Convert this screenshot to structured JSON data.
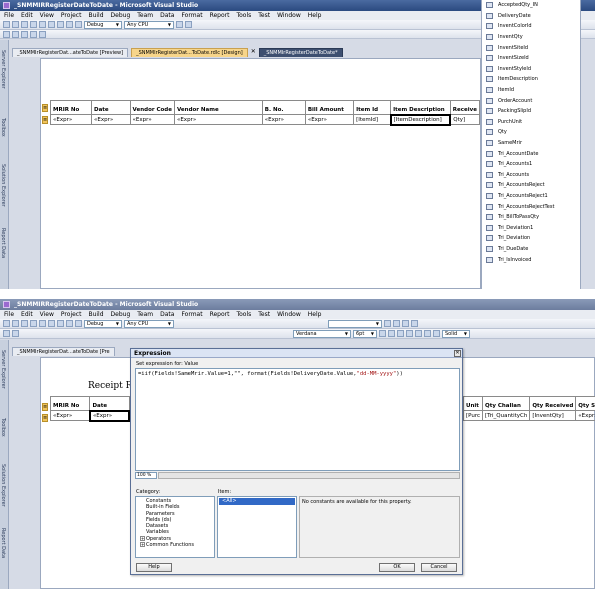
{
  "shot1": {
    "window_title": "_SNMMIRRegisterDateToDate - Microsoft Visual Studio",
    "menus": [
      "File",
      "Edit",
      "View",
      "Project",
      "Build",
      "Debug",
      "Team",
      "Data",
      "Format",
      "Report",
      "Tools",
      "Test",
      "Window",
      "Help"
    ],
    "config_combo": "Debug",
    "platform_combo": "Any CPU",
    "doc_tabs": [
      "_SNMMIrRegisterDat...ateToDate [Preview]",
      "_SNMMIrRegisterDat...ToDate.rdlc [Design]",
      "_SNMMIrRegisterDateToDate*"
    ],
    "side_tabs": [
      "Server Explorer",
      "Toolbox",
      "Solution Explorer",
      "Report Data"
    ],
    "table": {
      "headers": [
        "MRIR No",
        "Date",
        "Vendor Code",
        "Vendor Name",
        "B. No.",
        "Bill Amount",
        "Item Id",
        "Item Description",
        "Receive"
      ],
      "cells": [
        "«Expr»",
        "«Expr»",
        "«Expr»",
        "«Expr»",
        "«Expr»",
        "«Expr»",
        "[ItemId]",
        "[ItemDescription]",
        "Qty]"
      ]
    },
    "fields": [
      "AcceptedQty_IN",
      "DeliveryDate",
      "InventColorId",
      "InventQty",
      "InventSiteId",
      "InventSizeId",
      "InventStyleId",
      "ItemDescription",
      "ItemId",
      "OrderAccount",
      "PackingSlipId",
      "PurchUnit",
      "Qty",
      "SameMrir",
      "Tri_AccountDate",
      "Tri_Accounts1",
      "Tri_Accounts",
      "Tri_AccountsReject",
      "Tri_AccountsReject1",
      "Tri_AccountsRejectTest",
      "Tri_BillToPassQty",
      "Tri_Deviation1",
      "Tri_Deviation",
      "Tri_DueDate",
      "Tri_IsInvoiced"
    ]
  },
  "shot2": {
    "window_title": "_SNMMIRRegisterDateToDate - Microsoft Visual Studio",
    "menus": [
      "File",
      "Edit",
      "View",
      "Project",
      "Build",
      "Debug",
      "Team",
      "Data",
      "Format",
      "Report",
      "Tools",
      "Test",
      "Window",
      "Help"
    ],
    "config_combo": "Debug",
    "platform_combo": "Any CPU",
    "font_combo": "Verdana",
    "size_combo": "6pt",
    "border_combo": "Solid",
    "doc_tab": "_SNMMIrRegisterDat...ateToDate [Pre",
    "side_tabs": [
      "Server Explorer",
      "Toolbox",
      "Solution Explorer",
      "Report Data"
    ],
    "report_title_fragment": "Receipt R",
    "table_left": {
      "headers": [
        "MRIR No",
        "Date"
      ],
      "cells": [
        "«Expr»",
        "«Expr»"
      ]
    },
    "table_right": {
      "headers": [
        "Unit",
        "Qty Challan",
        "Qty Received",
        "Qty Sh"
      ],
      "cells": [
        "[Purc",
        "[Tri_QuantityCh",
        "[InventQty]",
        "«Expr»"
      ]
    },
    "dialog": {
      "title": "Expression",
      "close_glyph": "✕",
      "set_label": "Set expression for: Value",
      "expression_prefix": "=iif(Fields!SameMrir.Value=1,\"\", format(Fields!DeliveryDate.Value,",
      "expression_string": "\"dd-MM-yyyy\"",
      "expression_suffix": "))",
      "zoom": "100 %",
      "category_label": "Category:",
      "item_label": "Item:",
      "categories": [
        {
          "label": "Constants",
          "expander": ""
        },
        {
          "label": "Built-in Fields",
          "expander": ""
        },
        {
          "label": "Parameters",
          "expander": ""
        },
        {
          "label": "Fields (ds)",
          "expander": ""
        },
        {
          "label": "Datasets",
          "expander": ""
        },
        {
          "label": "Variables",
          "expander": ""
        },
        {
          "label": "Operators",
          "expander": "+"
        },
        {
          "label": "Common Functions",
          "expander": "+"
        }
      ],
      "item_selected": "<All>",
      "info_text": "No constants are available for this property.",
      "help_button": "Help",
      "ok_button": "OK",
      "cancel_button": "Cancel"
    }
  }
}
